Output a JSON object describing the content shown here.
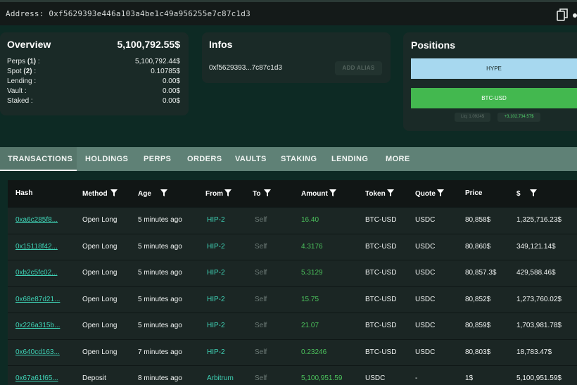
{
  "header": {
    "address_text": "Address: 0xf5629393e446a103a4be1c49a956255e7c87c1d3",
    "copy_icon": "copy-icon",
    "more_icon": "more-icon"
  },
  "overview": {
    "title": "Overview",
    "total": "5,100,792.55$",
    "rows": [
      {
        "label_prefix": "Perps ",
        "label_count": "(1)",
        "label_suffix": " :",
        "value": "5,100,792.44$"
      },
      {
        "label_prefix": "Spot ",
        "label_count": "(2)",
        "label_suffix": " :",
        "value": "0.10785$"
      },
      {
        "label_prefix": "Lending :",
        "label_count": "",
        "label_suffix": "",
        "value": "0.00$"
      },
      {
        "label_prefix": "Vault :",
        "label_count": "",
        "label_suffix": "",
        "value": "0.00$"
      },
      {
        "label_prefix": "Staked :",
        "label_count": "",
        "label_suffix": "",
        "value": "0.00$"
      }
    ]
  },
  "infos": {
    "title": "Infos",
    "short_address": "0xf5629393...7c87c1d3",
    "add_alias_label": "ADD ALIAS"
  },
  "positions": {
    "title": "Positions",
    "hype_label": "HYPE",
    "btc_label": "BTC-USD",
    "liq_label": "Liq: 1.0924$",
    "pnl_label": "+3,102,734.57$",
    "colors": {
      "hype": "#a7d8ef",
      "btc": "#43b84f"
    }
  },
  "tabs": [
    "TRANSACTIONS",
    "HOLDINGS",
    "PERPS",
    "ORDERS",
    "VAULTS",
    "STAKING",
    "LENDING",
    "MORE"
  ],
  "active_tab": "TRANSACTIONS",
  "table": {
    "columns": [
      "Hash",
      "Method",
      "Age",
      "From",
      "To",
      "Amount",
      "Token",
      "Quote",
      "Price",
      "$"
    ],
    "filter_icon": "filter-icon",
    "rows": [
      {
        "hash": "0xa6c285f8...",
        "method": "Open Long",
        "age": "5 minutes ago",
        "from": "HIP-2",
        "to": "Self",
        "amount": "16.40",
        "token": "BTC-USD",
        "quote": "USDC",
        "price": "80,858$",
        "usd": "1,325,716.23$"
      },
      {
        "hash": "0x15118f42...",
        "method": "Open Long",
        "age": "5 minutes ago",
        "from": "HIP-2",
        "to": "Self",
        "amount": "4.3176",
        "token": "BTC-USD",
        "quote": "USDC",
        "price": "80,860$",
        "usd": "349,121.14$"
      },
      {
        "hash": "0xb2c5fc02...",
        "method": "Open Long",
        "age": "5 minutes ago",
        "from": "HIP-2",
        "to": "Self",
        "amount": "5.3129",
        "token": "BTC-USD",
        "quote": "USDC",
        "price": "80,857.3$",
        "usd": "429,588.46$"
      },
      {
        "hash": "0x68e87d21...",
        "method": "Open Long",
        "age": "5 minutes ago",
        "from": "HIP-2",
        "to": "Self",
        "amount": "15.75",
        "token": "BTC-USD",
        "quote": "USDC",
        "price": "80,852$",
        "usd": "1,273,760.02$"
      },
      {
        "hash": "0x226a315b...",
        "method": "Open Long",
        "age": "5 minutes ago",
        "from": "HIP-2",
        "to": "Self",
        "amount": "21.07",
        "token": "BTC-USD",
        "quote": "USDC",
        "price": "80,859$",
        "usd": "1,703,981.78$"
      },
      {
        "hash": "0x640cd163...",
        "method": "Open Long",
        "age": "7 minutes ago",
        "from": "HIP-2",
        "to": "Self",
        "amount": "0.23246",
        "token": "BTC-USD",
        "quote": "USDC",
        "price": "80,803$",
        "usd": "18,783.47$"
      },
      {
        "hash": "0x67a61f65...",
        "method": "Deposit",
        "age": "8 minutes ago",
        "from": "Arbitrum",
        "to": "Self",
        "amount": "5,100,951.59",
        "token": "USDC",
        "quote": "-",
        "price": "1$",
        "usd": "5,100,951.59$"
      }
    ]
  }
}
